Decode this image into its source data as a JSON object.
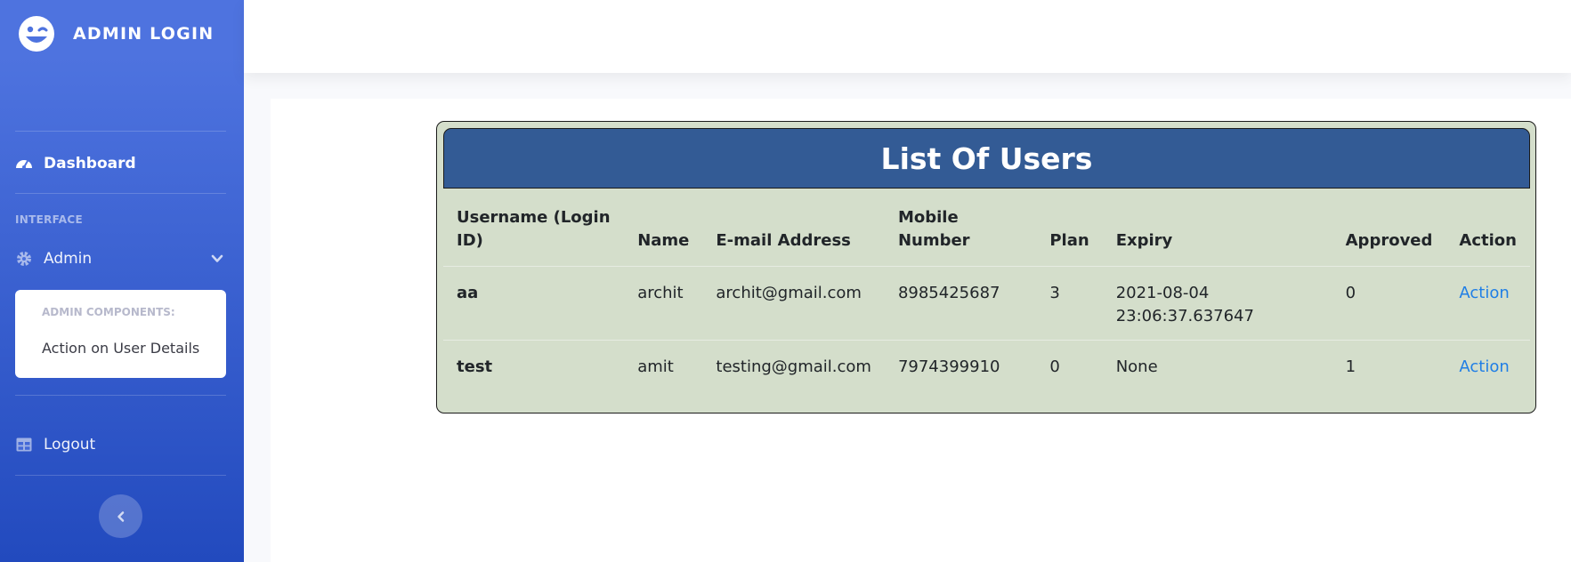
{
  "sidebar": {
    "brand": "ADMIN LOGIN",
    "dashboard_label": "Dashboard",
    "section_heading": "INTERFACE",
    "admin_label": "Admin",
    "collapse_header": "ADMIN COMPONENTS:",
    "collapse_item": "Action on User Details",
    "logout_label": "Logout"
  },
  "users_panel": {
    "title": "List Of Users",
    "columns": [
      "Username (Login ID)",
      "Name",
      "E-mail Address",
      "Mobile Number",
      "Plan",
      "Expiry",
      "Approved",
      "Action"
    ],
    "rows": [
      {
        "username": "aa",
        "name": "archit",
        "email": "archit@gmail.com",
        "mobile": "8985425687",
        "plan": "3",
        "expiry": "2021-08-04 23:06:37.637647",
        "approved": "0",
        "action": "Action"
      },
      {
        "username": "test",
        "name": "amit",
        "email": "testing@gmail.com",
        "mobile": "7974399910",
        "plan": "0",
        "expiry": "None",
        "approved": "1",
        "action": "Action"
      }
    ]
  },
  "icons": {
    "brand": "laugh-wink-icon",
    "dashboard": "tachometer-icon",
    "admin": "gear-icon",
    "admin_toggle": "chevron-down-icon",
    "logout": "table-icon",
    "sidebar_toggle": "chevron-left-icon"
  },
  "colors": {
    "sidebar_gradient_top": "#4e73df",
    "sidebar_gradient_bottom": "#224abe",
    "panel_header": "#335b95",
    "panel_body": "#d4decb",
    "link": "#1f7ee6"
  }
}
